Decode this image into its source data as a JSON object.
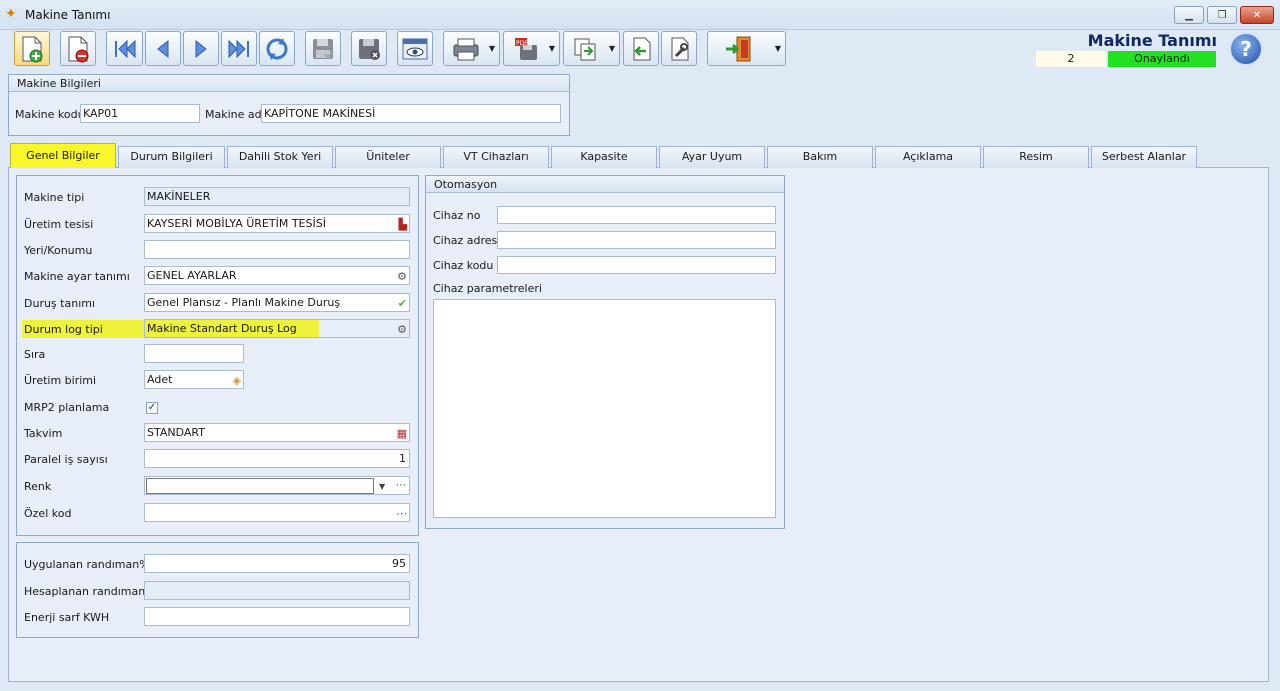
{
  "window": {
    "title": "Makine Tanımı"
  },
  "header": {
    "form_title": "Makine Tanımı",
    "record_no": "2",
    "status": "Onaylandı"
  },
  "toolbar": {
    "icons": [
      "new-record-icon",
      "delete-record-icon",
      "first-record-icon",
      "previous-record-icon",
      "next-record-icon",
      "last-record-icon",
      "refresh-icon",
      "save-icon",
      "save-cancel-icon",
      "preview-icon",
      "print-icon",
      "pdf-export-icon",
      "copy-icon",
      "import-icon",
      "tools-icon",
      "exit-icon",
      "help-icon"
    ]
  },
  "makine_bilgileri": {
    "title": "Makine Bilgileri",
    "kod_label": "Makine kodu",
    "kod_value": "KAP01",
    "adi_label": "Makine adı",
    "adi_value": "KAPİTONE MAKİNESİ"
  },
  "tabs": [
    "Genel Bilgiler",
    "Durum Bilgileri",
    "Dahili Stok Yeri",
    "Üniteler",
    "VT Cihazları",
    "Kapasite",
    "Ayar Uyum",
    "Bakım",
    "Açıklama",
    "Resim",
    "Serbest Alanlar"
  ],
  "genel": {
    "makine_tipi": {
      "label": "Makine tipi",
      "value": "MAKİNELER"
    },
    "uretim_tesisi": {
      "label": "Üretim tesisi",
      "value": "KAYSERİ MOBİLYA ÜRETİM TESİSİ"
    },
    "yeri": {
      "label": "Yeri/Konumu",
      "value": ""
    },
    "ayar": {
      "label": "Makine ayar tanımı",
      "value": "GENEL AYARLAR"
    },
    "durus": {
      "label": "Duruş tanımı",
      "value": "Genel Plansız - Planlı Makine Duruş"
    },
    "durum_log": {
      "label": "Durum log tipi",
      "value": "Makine Standart Duruş Log"
    },
    "sira": {
      "label": "Sıra",
      "value": ""
    },
    "birim": {
      "label": "Üretim birimi",
      "value": "Adet"
    },
    "mrp2": {
      "label": "MRP2 planlama",
      "checked": true
    },
    "takvim": {
      "label": "Takvim",
      "value": "STANDART"
    },
    "paralel": {
      "label": "Paralel iş sayısı",
      "value": "1"
    },
    "renk": {
      "label": "Renk",
      "value": ""
    },
    "ozel": {
      "label": "Özel kod",
      "value": ""
    }
  },
  "randiman": {
    "uygulanan": {
      "label": "Uygulanan randıman%",
      "value": "95"
    },
    "hesaplanan": {
      "label": "Hesaplanan randıman%",
      "value": ""
    },
    "enerji": {
      "label": "Enerji sarf KWH",
      "value": ""
    }
  },
  "otomasyon": {
    "title": "Otomasyon",
    "cihaz_no": {
      "label": "Cihaz no",
      "value": ""
    },
    "cihaz_adresi": {
      "label": "Cihaz adresi",
      "value": ""
    },
    "cihaz_kodu": {
      "label": "Cihaz kodu",
      "value": ""
    },
    "cihaz_param": {
      "label": "Cihaz parametreleri",
      "value": ""
    }
  },
  "colors": {
    "active_tab": "#f7f72a",
    "status_ok": "#22e022",
    "title_navy": "#0f2a63"
  }
}
